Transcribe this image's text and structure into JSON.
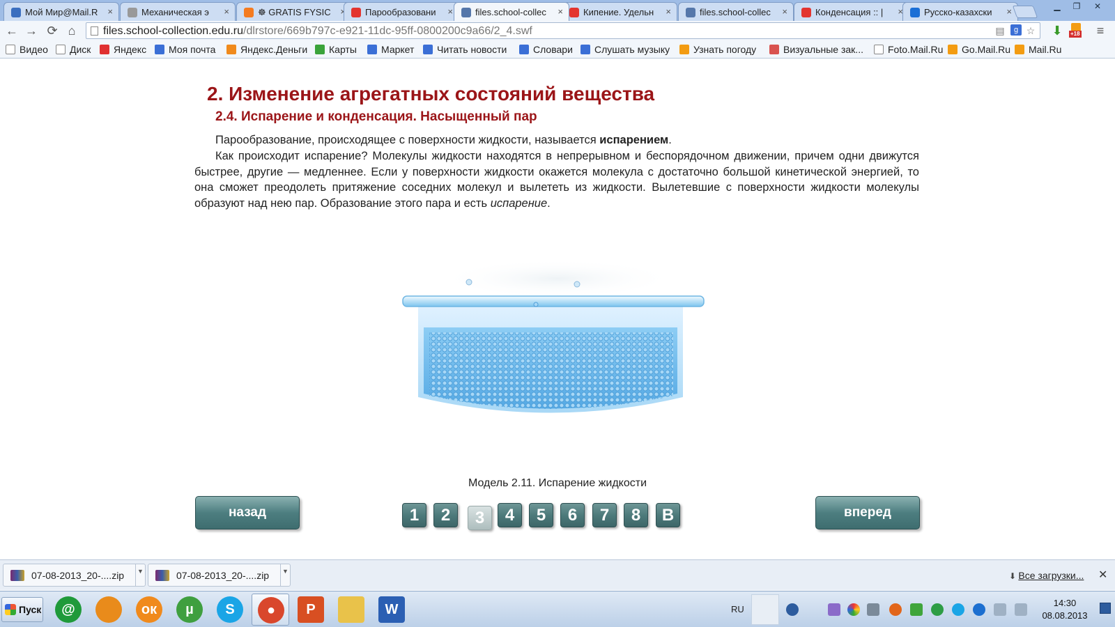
{
  "browser": {
    "tabs": [
      {
        "label": "Мой Мир@Mail.R",
        "icon": "mailru-world-icon",
        "color": "#3b6fbf"
      },
      {
        "label": "Механическая э",
        "icon": "page-icon",
        "color": "#999999"
      },
      {
        "label": "☸ GRATIS FYSIC",
        "icon": "blogger-icon",
        "color": "#f47b20"
      },
      {
        "label": "Парообразовани",
        "icon": "k-icon",
        "color": "#e3342f"
      },
      {
        "label": "files.school-collec",
        "icon": "school-collection-icon",
        "color": "#5577aa",
        "active": true
      },
      {
        "label": "Кипение. Удельн",
        "icon": "k-icon",
        "color": "#e3342f"
      },
      {
        "label": "files.school-collec",
        "icon": "school-collection-icon",
        "color": "#5577aa"
      },
      {
        "label": "Конденсация :: |",
        "icon": "k-icon",
        "color": "#e3342f"
      },
      {
        "label": "Русско-казахски",
        "icon": "s-icon",
        "color": "#1b6fd6"
      }
    ],
    "url_host": "files.school-collection.edu.ru",
    "url_path": "/dlrstore/669b797c-e921-11dc-95ff-0800200c9a66/2_4.swf",
    "badge": "+18",
    "bookmarks": [
      {
        "label": "Видео",
        "icon": "page-icon"
      },
      {
        "label": "Диск",
        "icon": "page-icon"
      },
      {
        "label": "Яндекс",
        "icon": "yandex-icon"
      },
      {
        "label": "Моя почта",
        "icon": "mail-icon"
      },
      {
        "label": "Яндекс.Деньги",
        "icon": "yandex-money-icon"
      },
      {
        "label": "Карты",
        "icon": "maps-icon"
      },
      {
        "label": "Маркет",
        "icon": "market-icon"
      },
      {
        "label": "Читать новости",
        "icon": "news-icon"
      },
      {
        "label": "Словари",
        "icon": "dictionary-icon"
      },
      {
        "label": "Слушать музыку",
        "icon": "music-icon"
      },
      {
        "label": "Узнать погоду",
        "icon": "weather-icon"
      },
      {
        "label": "Визуальные зак...",
        "icon": "grid-icon"
      },
      {
        "label": "Foto.Mail.Ru",
        "icon": "page-icon"
      },
      {
        "label": "Go.Mail.Ru",
        "icon": "search-icon"
      },
      {
        "label": "Mail.Ru",
        "icon": "mailru-icon"
      }
    ]
  },
  "page": {
    "title": "2. Изменение агрегатных состояний вещества",
    "subtitle": "2.4. Испарение и конденсация. Насыщенный пар",
    "p1_text": "Парообразование, происходящее с поверхности жидкости, называется ",
    "p1_bold": "испарением",
    "p1_end": ".",
    "p2_text": "Как происходит испарение? Молекулы жидкости находятся в непрерывном и беспорядочном движении, причем одни движутся быстрее, другие — медленнее. Если у поверхности жидкости окажется молекула с достаточно большой кинетической энергией, то она сможет преодолеть притяжение соседних молекул и вылететь из жидкости. Вылетевшие с поверхности жидкости молекулы образуют над нею пар. Образование этого пара и есть ",
    "p2_italic": "испарение",
    "p2_end": ".",
    "caption": "Модель 2.11. Испарение жидкости",
    "back_label": "назад",
    "forward_label": "вперед",
    "pages": [
      "1",
      "2",
      "3",
      "4",
      "5",
      "6",
      "7",
      "8",
      "В"
    ],
    "current_page": "3"
  },
  "downloads": {
    "items": [
      "07-08-2013_20-....zip",
      "07-08-2013_20-....zip"
    ],
    "all_label": "Все загрузки..."
  },
  "taskbar": {
    "start_label": "Пуск",
    "lang": "RU",
    "time": "14:30",
    "date": "08.08.2013",
    "apps": [
      {
        "name": "mail-agent-icon",
        "color": "#1f9a3a",
        "glyph": "@"
      },
      {
        "name": "mailru-app-icon",
        "color": "#e98b1b",
        "glyph": ""
      },
      {
        "name": "odnoklassniki-icon",
        "color": "#f08a1c",
        "glyph": "ок"
      },
      {
        "name": "utorrent-icon",
        "color": "#3f9f3f",
        "glyph": "µ"
      },
      {
        "name": "skype-icon",
        "color": "#1aa5e6",
        "glyph": "S"
      },
      {
        "name": "chrome-icon",
        "color": "#d9472c",
        "glyph": "●"
      },
      {
        "name": "presentation-icon",
        "color": "#d84f22",
        "glyph": "P"
      },
      {
        "name": "folder-icon",
        "color": "#e9c24a",
        "glyph": ""
      },
      {
        "name": "word-icon",
        "color": "#2b5fb3",
        "glyph": "W"
      }
    ]
  }
}
